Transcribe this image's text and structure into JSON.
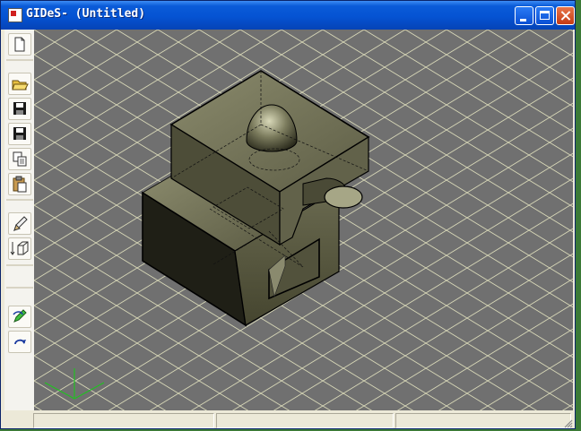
{
  "window": {
    "title": "GIDeS- (Untitled)"
  },
  "caption_buttons": {
    "minimize": "minimize",
    "maximize": "maximize",
    "close": "close"
  },
  "toolbar": {
    "buttons": [
      {
        "name": "new-button",
        "icon": "new-document-icon"
      },
      {
        "name": "open-button",
        "icon": "open-folder-icon"
      },
      {
        "name": "save-button",
        "icon": "save-disk-icon"
      },
      {
        "name": "save-as-button",
        "icon": "save-disk-icon"
      },
      {
        "name": "copy-button",
        "icon": "copy-icon"
      },
      {
        "name": "paste-button",
        "icon": "paste-icon"
      },
      {
        "name": "pencil-button",
        "icon": "pencil-icon"
      },
      {
        "name": "extrude-button",
        "icon": "extrude-icon"
      },
      {
        "name": "undo-button",
        "icon": "undo-icon"
      },
      {
        "name": "redo-button",
        "icon": "redo-icon"
      }
    ]
  },
  "viewport": {
    "grid_color": "#d9d9b8",
    "background_color": "#707070",
    "model_color": "#6b6b53",
    "axis_color": "#22c022"
  },
  "status_bar": {
    "panes": [
      "",
      "",
      ""
    ]
  }
}
